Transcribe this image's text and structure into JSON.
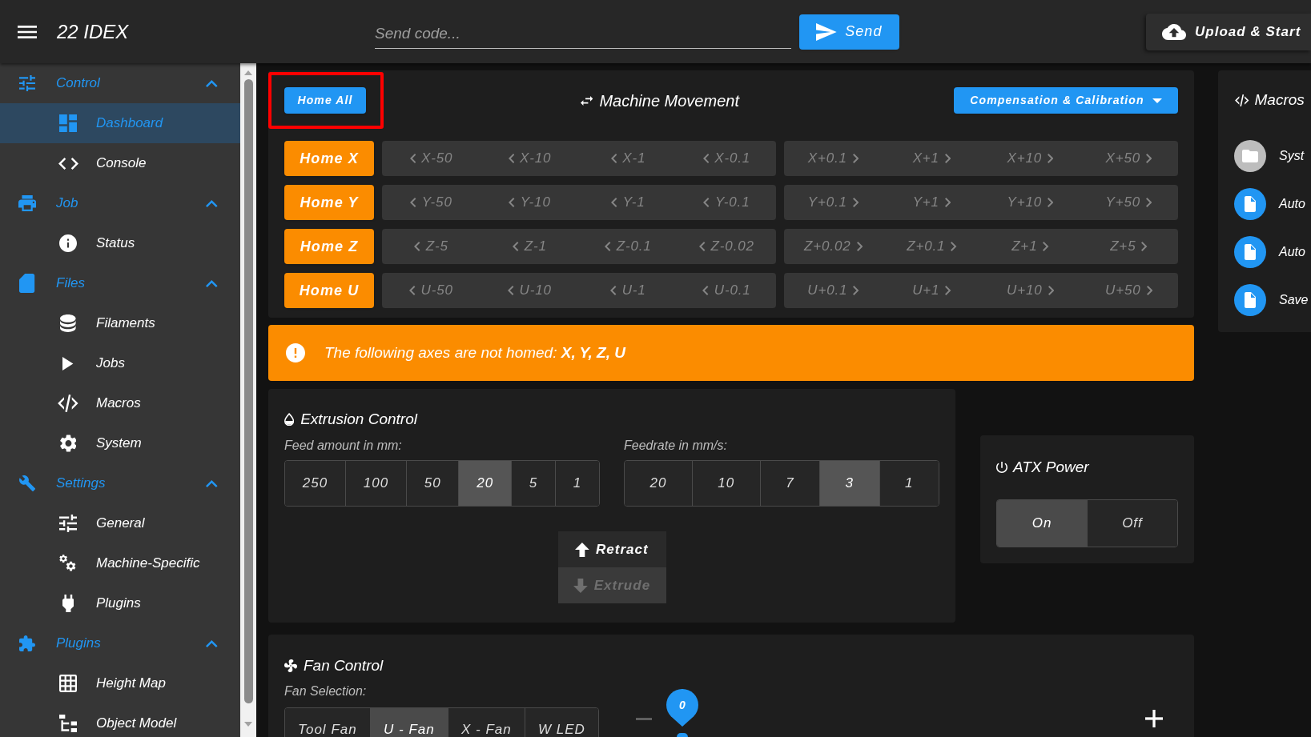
{
  "app_bar": {
    "title": "22 IDEX",
    "code_field": {
      "placeholder": "Send code..."
    },
    "send_button": "Send",
    "upload_button": "Upload & Start"
  },
  "sidebar": {
    "groups": [
      {
        "label": "Control",
        "expanded": true,
        "items": [
          {
            "label": "Dashboard",
            "selected": true
          },
          {
            "label": "Console",
            "selected": false
          }
        ]
      },
      {
        "label": "Job",
        "expanded": true,
        "items": [
          {
            "label": "Status",
            "selected": false
          }
        ]
      },
      {
        "label": "Files",
        "expanded": true,
        "items": [
          {
            "label": "Filaments",
            "selected": false
          },
          {
            "label": "Jobs",
            "selected": false
          },
          {
            "label": "Macros",
            "selected": false
          },
          {
            "label": "System",
            "selected": false
          }
        ]
      },
      {
        "label": "Settings",
        "expanded": true,
        "items": [
          {
            "label": "General",
            "selected": false
          },
          {
            "label": "Machine-Specific",
            "selected": false
          },
          {
            "label": "Plugins",
            "selected": false
          }
        ]
      },
      {
        "label": "Plugins",
        "expanded": true,
        "items": [
          {
            "label": "Height Map",
            "selected": false
          },
          {
            "label": "Object Model",
            "selected": false
          }
        ]
      }
    ]
  },
  "machine_movement": {
    "home_all_button": "Home All",
    "title": "Machine Movement",
    "compensation_button": "Compensation & Calibration",
    "axes": [
      {
        "home_button": "Home X",
        "disabled": true,
        "decrease_steps": [
          "X-50",
          "X-10",
          "X-1",
          "X-0.1"
        ],
        "increase_steps": [
          "X+0.1",
          "X+1",
          "X+10",
          "X+50"
        ]
      },
      {
        "home_button": "Home Y",
        "disabled": true,
        "decrease_steps": [
          "Y-50",
          "Y-10",
          "Y-1",
          "Y-0.1"
        ],
        "increase_steps": [
          "Y+0.1",
          "Y+1",
          "Y+10",
          "Y+50"
        ]
      },
      {
        "home_button": "Home Z",
        "disabled": true,
        "decrease_steps": [
          "Z-5",
          "Z-1",
          "Z-0.1",
          "Z-0.02"
        ],
        "increase_steps": [
          "Z+0.02",
          "Z+0.1",
          "Z+1",
          "Z+5"
        ]
      },
      {
        "home_button": "Home U",
        "disabled": true,
        "decrease_steps": [
          "U-50",
          "U-10",
          "U-1",
          "U-0.1"
        ],
        "increase_steps": [
          "U+0.1",
          "U+1",
          "U+10",
          "U+50"
        ]
      }
    ]
  },
  "alert": {
    "text": "The following axes are not homed: **X, Y, Z, U**"
  },
  "extrusion_control": {
    "title": "Extrusion Control",
    "feed_amount": {
      "label": "Feed amount in mm:",
      "options": [
        {
          "label": "250",
          "selected": false
        },
        {
          "label": "100",
          "selected": false
        },
        {
          "label": "50",
          "selected": false
        },
        {
          "label": "20",
          "selected": true
        },
        {
          "label": "5",
          "selected": false
        },
        {
          "label": "1",
          "selected": false
        }
      ]
    },
    "feedrate": {
      "label": "Feedrate in mm/s:",
      "options": [
        {
          "label": "20",
          "selected": false
        },
        {
          "label": "10",
          "selected": false
        },
        {
          "label": "7",
          "selected": false
        },
        {
          "label": "3",
          "selected": true
        },
        {
          "label": "1",
          "selected": false
        }
      ]
    },
    "actions": [
      {
        "label": "Retract",
        "disabled": false
      },
      {
        "label": "Extrude",
        "disabled": true
      }
    ]
  },
  "atx_power": {
    "title": "ATX Power",
    "options": [
      {
        "label": "On",
        "selected": true
      },
      {
        "label": "Off",
        "selected": false
      }
    ]
  },
  "fan_control": {
    "title": "Fan Control",
    "selection_label": "Fan Selection:",
    "fans": [
      {
        "label": "Tool Fan",
        "selected": false
      },
      {
        "label": "U - Fan",
        "selected": true
      },
      {
        "label": "X - Fan",
        "selected": false
      },
      {
        "label": "W LED",
        "selected": false
      }
    ],
    "speed_slider": {
      "level": 0,
      "reading": "0"
    }
  },
  "macros": {
    "title": "Macros",
    "items": [
      {
        "label": "Syst",
        "kind": "folder"
      },
      {
        "label": "Auto",
        "kind": "file"
      },
      {
        "label": "Auto",
        "kind": "file"
      },
      {
        "label": "Save",
        "kind": "file"
      }
    ]
  }
}
